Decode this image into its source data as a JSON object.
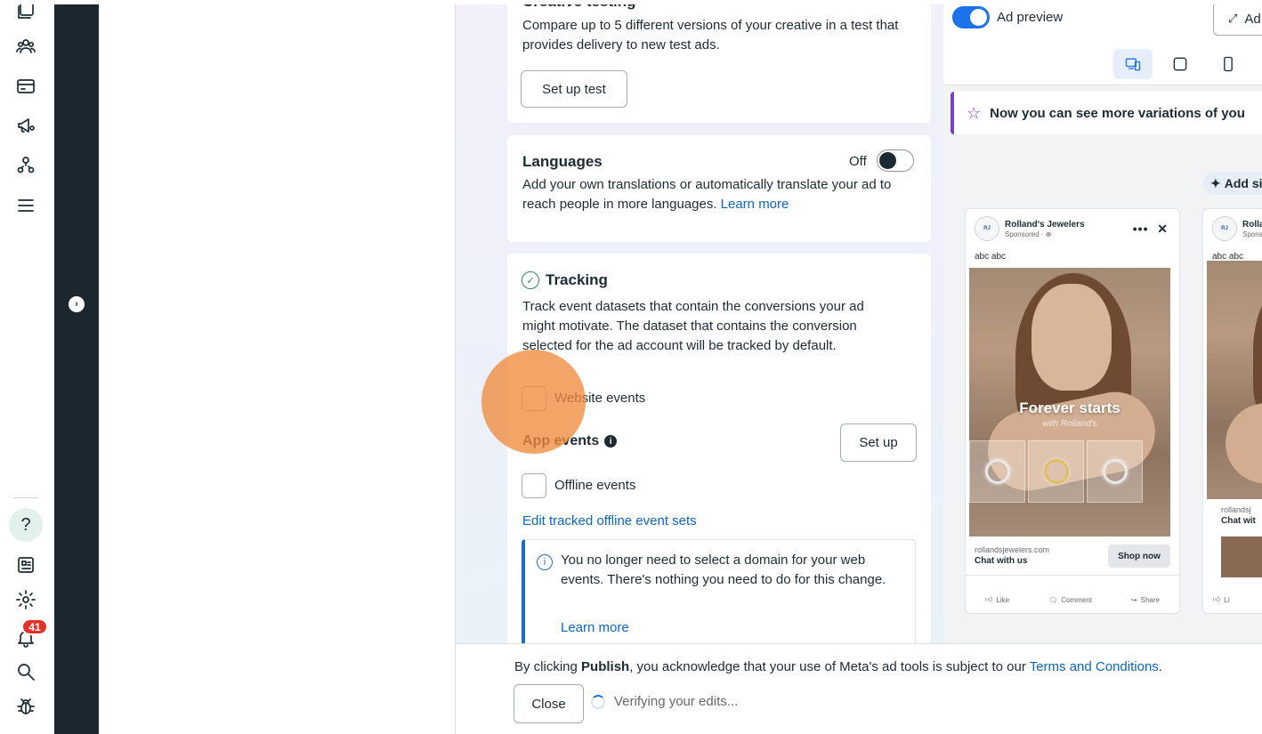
{
  "creative_testing": {
    "title": "Creative testing",
    "description": "Compare up to 5 different versions of your creative in a test that provides delivery to new test ads.",
    "button": "Set up test"
  },
  "languages": {
    "title": "Languages",
    "toggle_state": "Off",
    "description": "Add your own translations or automatically translate your ad to reach people in more languages.",
    "link": "Learn more"
  },
  "tracking": {
    "title": "Tracking",
    "description": "Track event datasets that contain the conversions your ad might motivate. The dataset that contains the conversion selected for the ad account will be tracked by default.",
    "website_events": "Website events",
    "app_events": "App events",
    "app_events_button": "Set up",
    "offline_events": "Offline events",
    "edit_link": "Edit tracked offline event sets",
    "notice": "You no longer need to select a domain for your web events. There's nothing you need to do for this change.",
    "notice_link": "Learn more"
  },
  "preview": {
    "toggle_label": "Ad preview",
    "expand_button": "Ad",
    "banner": "Now you can see more variations of you",
    "add_button": "Add si"
  },
  "ads": [
    {
      "page_name": "Rolland's Jewelers",
      "sponsored": "Sponsored · ⊕",
      "primary_text": "abc abc",
      "headline_overlay": "Forever starts",
      "sub_overlay": "with Rolland's",
      "domain": "rollandsjewelers.com",
      "cta_text": "Chat with us",
      "button": "Shop now",
      "actions": [
        "Like",
        "Comment",
        "Share"
      ]
    },
    {
      "page_name": "Rolland's",
      "sponsored": "Spons",
      "primary_text": "abc abc",
      "domain": "rollandsj",
      "cta_text": "Chat wit",
      "actions": [
        "Li"
      ]
    }
  ],
  "footer": {
    "legal_prefix": "By clicking ",
    "legal_bold": "Publish",
    "legal_middle": ", you acknowledge that your use of Meta's ad tools is subject to our ",
    "legal_link": "Terms and Conditions",
    "legal_end": ".",
    "close_button": "Close",
    "status": "Verifying your edits..."
  },
  "sidebar": {
    "notifications_count": "41",
    "help_label": "?"
  },
  "colors": {
    "accent": "#0a66c2",
    "dark_strip": "#1b262e",
    "notice_border": "#1b6ec2",
    "banner_border": "#7a3fd1",
    "badge": "#e4322b"
  }
}
